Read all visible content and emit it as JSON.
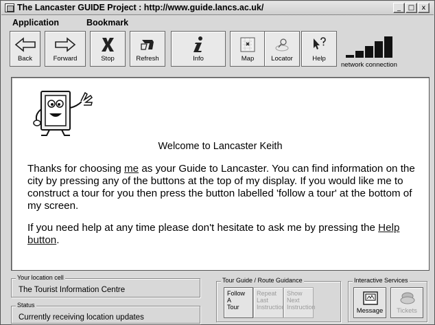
{
  "window": {
    "title": "The Lancaster GUIDE Project : http://www.guide.lancs.ac.uk/",
    "controls": [
      "_",
      "□",
      "x"
    ]
  },
  "menubar": [
    "Application",
    "Bookmark"
  ],
  "toolbar": {
    "buttons": [
      "Back",
      "Forward",
      "Stop",
      "Refresh",
      "Info",
      "Map",
      "Locator",
      "Help"
    ],
    "network_label": "network connection",
    "signal_bars": 5
  },
  "content": {
    "welcome": "Welcome to Lancaster Keith",
    "para1_a": "Thanks for choosing ",
    "para1_link": "me",
    "para1_b": " as your Guide to Lancaster. You can find information on the city by pressing any of the buttons at the top of my display. If you would like me to construct a tour for you then press the button labelled 'follow a tour' at the bottom of my screen.",
    "para2_a": "If you need help at any time please don't hesitate to ask me by pressing the ",
    "para2_link": "Help button",
    "para2_b": "."
  },
  "status": {
    "location_caption": "Your location cell",
    "location_value": "The Tourist Information Centre",
    "status_caption": "Status",
    "status_value": "Currently receiving location updates"
  },
  "tour": {
    "caption": "Tour Guide / Route Guidance",
    "follow": [
      "Follow",
      "A",
      "Tour"
    ],
    "repeat": [
      "Repeat",
      "Last",
      "Instruction"
    ],
    "show": [
      "Show",
      "Next",
      "Instruction"
    ]
  },
  "services": {
    "caption": "Interactive Services",
    "message": "Message",
    "tickets": "Tickets"
  }
}
